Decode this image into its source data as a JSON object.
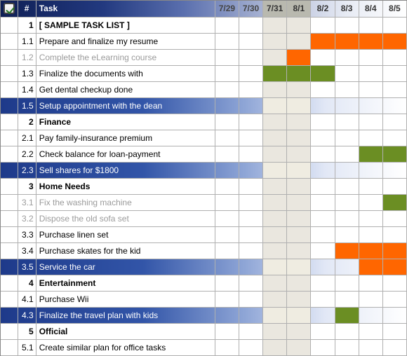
{
  "header": {
    "check": "✓",
    "num": "#",
    "task": "Task",
    "days": [
      "7/29",
      "7/30",
      "7/31",
      "8/1",
      "8/2",
      "8/3",
      "8/4",
      "8/5"
    ]
  },
  "rows": [
    {
      "num": "1",
      "task": "[ SAMPLE TASK LIST ]",
      "top": true
    },
    {
      "num": "1.1",
      "task": "Prepare and finalize my resume",
      "bars": {
        "8/2": "orange",
        "8/3": "orange",
        "8/4": "orange",
        "8/5": "orange"
      }
    },
    {
      "num": "1.2",
      "task": "Complete the eLearning course",
      "dim": true,
      "bars": {
        "8/1": "orange"
      }
    },
    {
      "num": "1.3",
      "task": "Finalize the documents with",
      "bars": {
        "7/31": "green",
        "8/1": "green",
        "8/2": "green"
      }
    },
    {
      "num": "1.4",
      "task": "Get dental checkup done"
    },
    {
      "num": "1.5",
      "task": "Setup appointment with the dean",
      "hl": true
    },
    {
      "num": "2",
      "task": "Finance",
      "top": true
    },
    {
      "num": "2.1",
      "task": "Pay family-insurance premium"
    },
    {
      "num": "2.2",
      "task": "Check balance for loan-payment",
      "bars": {
        "8/4": "green",
        "8/5": "green"
      }
    },
    {
      "num": "2.3",
      "task": "Sell shares for $1800",
      "hl": true
    },
    {
      "num": "3",
      "task": "Home Needs",
      "top": true
    },
    {
      "num": "3.1",
      "task": "Fix the washing machine",
      "dim": true,
      "bars": {
        "8/5": "green"
      }
    },
    {
      "num": "3.2",
      "task": "Dispose the old sofa set",
      "dim": true
    },
    {
      "num": "3.3",
      "task": "Purchase linen set"
    },
    {
      "num": "3.4",
      "task": "Purchase skates for the kid",
      "bars": {
        "8/3": "orange",
        "8/4": "orange",
        "8/5": "orange"
      }
    },
    {
      "num": "3.5",
      "task": "Service the car",
      "hl": true,
      "bars": {
        "8/4": "orange",
        "8/5": "orange"
      }
    },
    {
      "num": "4",
      "task": "Entertainment",
      "top": true
    },
    {
      "num": "4.1",
      "task": "Purchase Wii"
    },
    {
      "num": "4.3",
      "task": "Finalize the travel plan with kids",
      "hl": true,
      "bars": {
        "8/3": "green"
      }
    },
    {
      "num": "5",
      "task": "Official",
      "top": true
    },
    {
      "num": "5.1",
      "task": "Create similar plan for office tasks"
    }
  ]
}
